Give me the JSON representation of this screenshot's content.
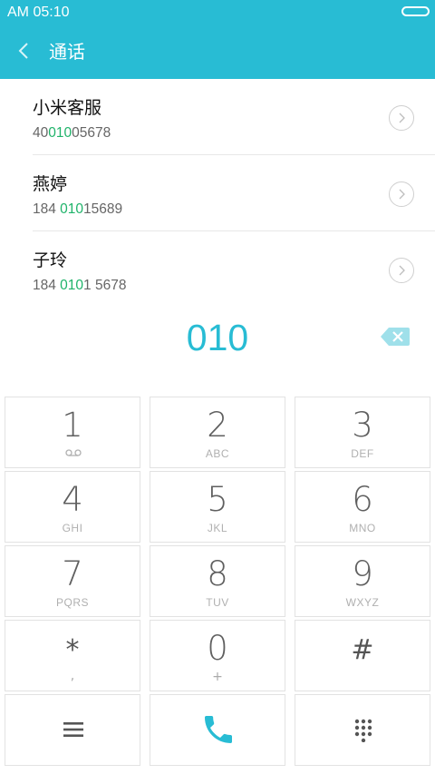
{
  "status_bar": {
    "time": "AM  05:10"
  },
  "header": {
    "title": "通话",
    "back_icon": "chevron-left-icon"
  },
  "contacts": [
    {
      "name": "小米客服",
      "number_pre": "40",
      "number_match": "010",
      "number_post": "05678"
    },
    {
      "name": "燕婷",
      "number_pre": "184 ",
      "number_match": "010",
      "number_post": "15689"
    },
    {
      "name": "子玲",
      "number_pre": "184 ",
      "number_match": "010",
      "number_post": "1 5678"
    }
  ],
  "dialed_number": "010",
  "keypad": [
    {
      "digit": "1",
      "letters": ""
    },
    {
      "digit": "2",
      "letters": "ABC"
    },
    {
      "digit": "3",
      "letters": "DEF"
    },
    {
      "digit": "4",
      "letters": "GHI"
    },
    {
      "digit": "5",
      "letters": "JKL"
    },
    {
      "digit": "6",
      "letters": "MNO"
    },
    {
      "digit": "7",
      "letters": "PQRS"
    },
    {
      "digit": "8",
      "letters": "TUV"
    },
    {
      "digit": "9",
      "letters": "WXYZ"
    },
    {
      "digit": "*",
      "letters": ","
    },
    {
      "digit": "0",
      "letters": "+"
    },
    {
      "digit": "#",
      "letters": ""
    }
  ],
  "colors": {
    "accent": "#28bcd4",
    "match": "#1fb36a"
  }
}
